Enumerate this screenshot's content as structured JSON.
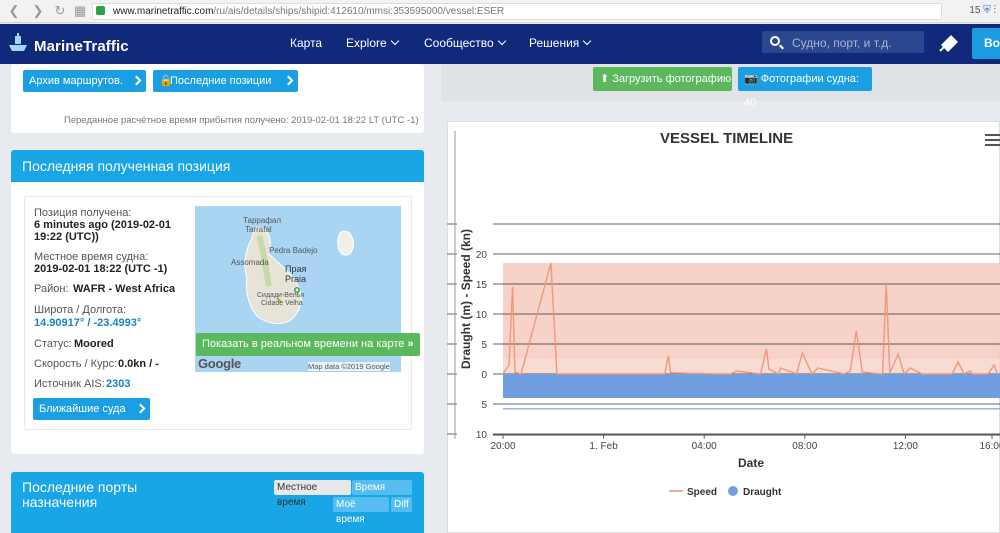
{
  "browser": {
    "url_host": "www.marinetraffic.com",
    "url_path": "/ru/ais/details/ships/shipid:412610/mmsi:353595000/vessel:ESER",
    "ext_count": "15"
  },
  "header": {
    "logo": "MarineTraffic",
    "menu": [
      "Карта",
      "Explore",
      "Сообщество",
      "Решения"
    ],
    "search_placeholder": "Судно, порт, и т.д.",
    "button": "Вой"
  },
  "routes": {
    "archive_btn": "Архив маршрутов.",
    "last_positions_btn": "Последние позиции",
    "eta": "Переданное расчётное время прибытия получено: 2019-02-01 18:22 LT (UTC -1)"
  },
  "position": {
    "title": "Последняя полученная позиция",
    "received_label": "Позиция получена:",
    "received_value": "6 minutes ago (2019-02-01 19:22 (UTC))",
    "local_time_label": "Местное время судна:",
    "local_time_value": "2019-02-01 18:22 (UTC -1)",
    "area_label": "Район:",
    "area_value": "WAFR - West Africa",
    "latlon_label": "Широта / Долгота:",
    "latlon_value": "14.90917° / -23.4993°",
    "status_label": "Статус:",
    "status_value": "Moored",
    "speed_label": "Скорость / Курс:",
    "speed_value": "0.0kn / -",
    "source_label": "Источник AIS:",
    "source_value": "2303",
    "nearby_btn": "Ближайшие суда",
    "map_live_btn": "Показать в реальном времени на карте",
    "map": {
      "labels": [
        "Таррафал",
        "Tarrafal",
        "Pedra Badejo",
        "Assomada",
        "Прая",
        "Praia",
        "Сидади-Велья",
        "Cidade Velha"
      ],
      "google": "Google",
      "attribution": "Map data ©2019 Google"
    }
  },
  "ports": {
    "title": "Последние порты назначения",
    "local_time": "Местное время",
    "utc_time": "Время (UTC)",
    "my_time": "Моё время",
    "diff": "Diff"
  },
  "photos": {
    "upload": "Загрузить фотографию",
    "vessel_photos": "Фотографии судна: 40"
  },
  "colors": {
    "header": "#10297a",
    "accent": "#18a6e6",
    "green": "#5cb85c",
    "speed": "#f0987a",
    "draught": "#6f9fe0"
  },
  "chart_data": {
    "type": "line",
    "title": "VESSEL TIMELINE",
    "xlabel": "Date",
    "ylabel": "Draught (m) - Speed (kn)",
    "x_ticks": [
      "20:00",
      "1. Feb",
      "04:00",
      "08:00",
      "12:00",
      "16:00"
    ],
    "y_ticks": [
      "20",
      "15",
      "10",
      "5",
      "0",
      "5",
      "10"
    ],
    "ylim": [
      -10,
      20
    ],
    "legend_position": "bottom",
    "series": [
      {
        "name": "Speed",
        "type": "line",
        "x_hours": [
          0,
          0.5,
          0.8,
          1.0,
          1.5,
          4.0,
          4.5,
          5.0,
          9,
          13.5,
          13.8,
          14,
          18,
          19,
          19.5,
          21.5,
          22,
          22.2,
          23,
          23.2,
          24.5,
          25,
          25.8,
          26.3,
          28.5,
          29,
          29.5,
          30,
          31.7,
          32,
          32.3,
          33,
          33.5,
          34,
          35,
          36,
          37.5,
          38,
          38.5,
          39,
          39.2,
          40,
          40.5,
          41,
          41.3
        ],
        "values": [
          0,
          1.5,
          14.5,
          0.3,
          0,
          18.5,
          0,
          0,
          0,
          0,
          3,
          0.2,
          0,
          0,
          0.5,
          0,
          4.2,
          0.8,
          0,
          1,
          0,
          3.5,
          0,
          1,
          0,
          0.5,
          7.2,
          0.3,
          0,
          15,
          0.2,
          3.3,
          0,
          1,
          0,
          0,
          0,
          2,
          0,
          0.5,
          0,
          0,
          0,
          1.5,
          0
        ]
      },
      {
        "name": "Draught",
        "type": "area",
        "value": -4
      }
    ],
    "band_speed": [
      0,
      18.5
    ],
    "reference_line": -5.8
  }
}
